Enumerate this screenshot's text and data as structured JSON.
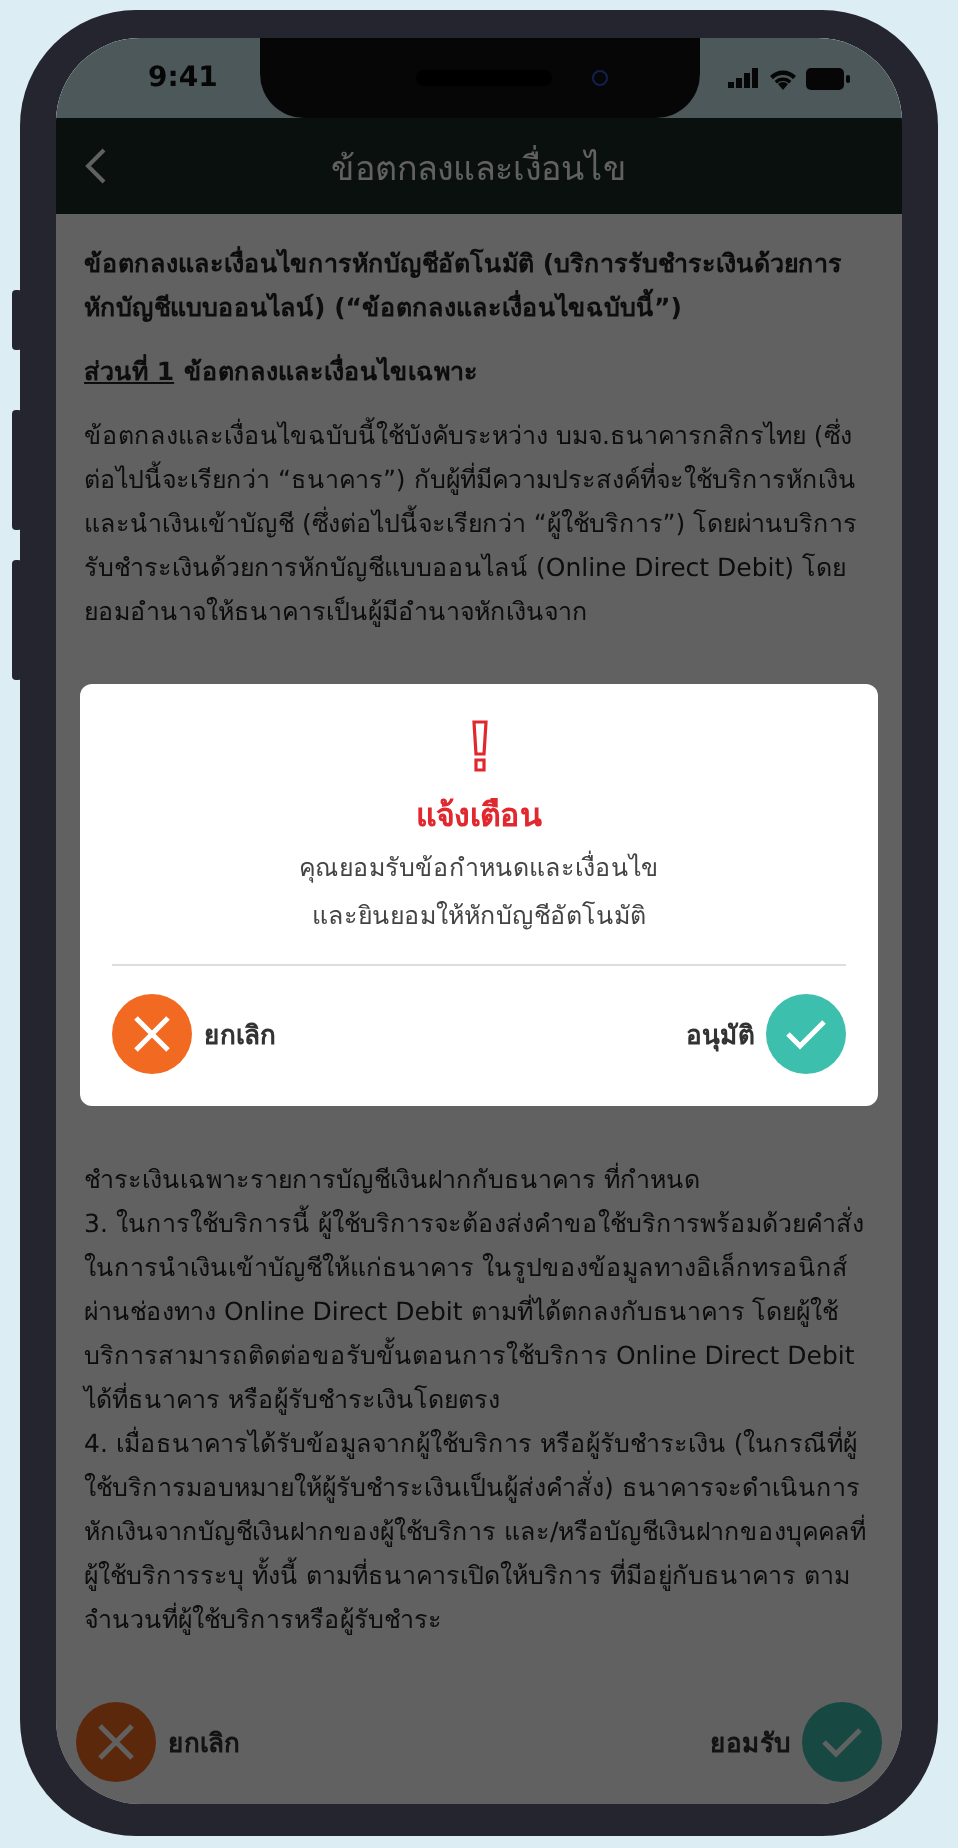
{
  "status_bar": {
    "time": "9:41"
  },
  "header": {
    "title": "ข้อตกลงและเงื่อนไข"
  },
  "terms": {
    "intro": "ข้อตกลงและเงื่อนไขการหักบัญชีอัตโนมัติ (บริการรับชำระเงินด้วยการหักบัญชีแบบออนไลน์) (“ข้อตกลงและเงื่อนไขฉบับนี้”)",
    "section_label": "ส่วนที่ 1",
    "section_title": "ข้อตกลงและเงื่อนไขเฉพาะ",
    "paragraphs": [
      "ข้อตกลงและเงื่อนไขฉบับนี้ใช้บังคับระหว่าง บมจ.ธนาคารกสิกรไทย (ซึ่งต่อไปนี้จะเรียกว่า “ธนาคาร”) กับผู้ที่มีความประสงค์ที่จะใช้บริการหักเงิน และนำเงินเข้าบัญชี (ซึ่งต่อไปนี้จะเรียกว่า “ผู้ใช้บริการ”) โดยผ่านบริการรับชำระเงินด้วยการหักบัญชีแบบออนไลน์ (Online Direct Debit) โดยยอมอำนาจให้ธนาคารเป็นผู้มีอำนาจหักเงินจาก",
      "ชำระเงินเฉพาะรายการบัญชีเงินฝากกับธนาคาร ที่กำหนด",
      "3. ในการใช้บริการนี้ ผู้ใช้บริการจะต้องส่งคำขอใช้บริการพร้อมด้วยคำสั่งในการนำเงินเข้าบัญชีให้แก่ธนาคาร ในรูปของข้อมูลทางอิเล็กทรอนิกส์ ผ่านช่องทาง Online Direct Debit ตามที่ได้ตกลงกับธนาคาร โดยผู้ใช้บริการสามารถติดต่อขอรับขั้นตอนการใช้บริการ Online Direct Debit ได้ที่ธนาคาร หรือผู้รับชำระเงินโดยตรง",
      "4. เมื่อธนาคารได้รับข้อมูลจากผู้ใช้บริการ หรือผู้รับชำระเงิน (ในกรณีที่ผู้ใช้บริการมอบหมายให้ผู้รับชำระเงินเป็นผู้ส่งคำสั่ง) ธนาคารจะดำเนินการหักเงินจากบัญชีเงินฝากของผู้ใช้บริการ และ/หรือบัญชีเงินฝากของบุคคลที่ผู้ใช้บริการระบุ ทั้งนี้ ตามที่ธนาคารเปิดให้บริการ ที่มีอยู่กับธนาคาร ตามจำนวนที่ผู้ใช้บริการหรือผู้รับชำระ"
    ]
  },
  "bottom_buttons": [
    {
      "kind": "cancel",
      "label": "ยกเลิก"
    },
    {
      "kind": "confirm",
      "label": "ยอมรับ"
    }
  ],
  "dialog": {
    "title": "แจ้งเตือน",
    "message": [
      "คุณยอมรับข้อกำหนดและเงื่อนไข",
      "และยินยอมให้หักบัญชีอัตโนมัติ"
    ],
    "buttons": [
      {
        "kind": "cancel",
        "label": "ยกเลิก"
      },
      {
        "kind": "confirm",
        "label": "อนุมัติ"
      }
    ]
  }
}
